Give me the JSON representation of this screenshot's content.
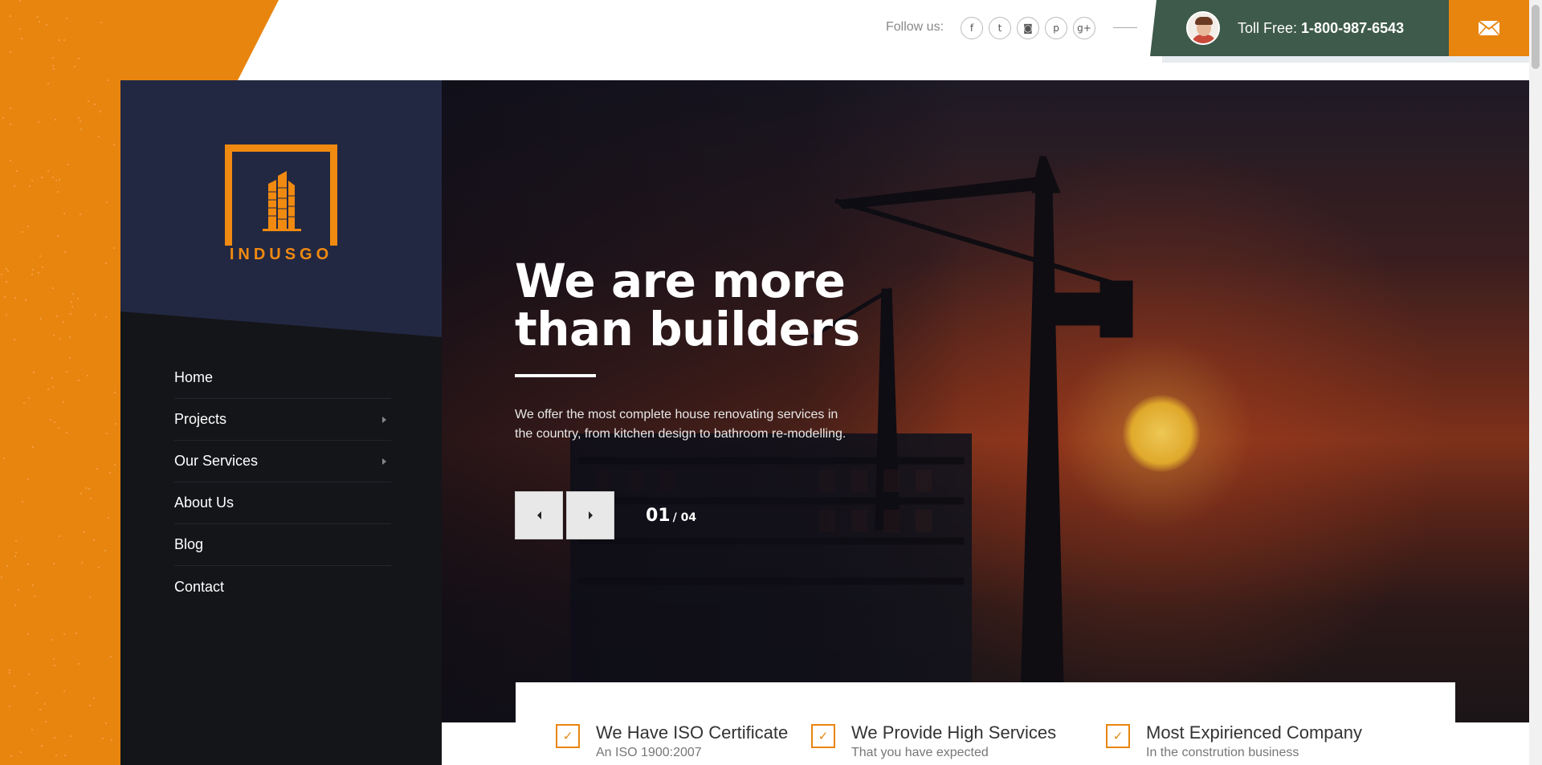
{
  "header": {
    "follow_label": "Follow us:",
    "social": [
      {
        "icon": "facebook-icon",
        "glyph": "f"
      },
      {
        "icon": "twitter-icon",
        "glyph": "t"
      },
      {
        "icon": "instagram-icon",
        "glyph": "◙"
      },
      {
        "icon": "pinterest-icon",
        "glyph": "p"
      },
      {
        "icon": "google-plus-icon",
        "glyph": "g+"
      }
    ],
    "toll_free_label": "Toll Free:",
    "toll_free_number": "1-800-987-6543",
    "mail_icon": "envelope-icon"
  },
  "brand": {
    "name": "INDUSGO",
    "accent_color": "#e8850f",
    "sidebar_color": "#232842",
    "toll_bar_color": "#3e5a4a"
  },
  "nav": {
    "items": [
      {
        "label": "Home",
        "has_submenu": false
      },
      {
        "label": "Projects",
        "has_submenu": true
      },
      {
        "label": "Our Services",
        "has_submenu": true
      },
      {
        "label": "About Us",
        "has_submenu": false
      },
      {
        "label": "Blog",
        "has_submenu": false
      },
      {
        "label": "Contact",
        "has_submenu": false
      }
    ]
  },
  "hero": {
    "title_line1": "We are more",
    "title_line2": "than builders",
    "description": "We offer the most complete house renovating services in the country, from kitchen design to bathroom re-modelling.",
    "slide_current": "01",
    "slide_total": "/ 04"
  },
  "features": [
    {
      "title": "We Have ISO Certificate",
      "subtitle": "An ISO 1900:2007"
    },
    {
      "title": "We Provide High Services",
      "subtitle": "That you have expected"
    },
    {
      "title": "Most Expirienced Company",
      "subtitle": "In the constrution business"
    }
  ]
}
